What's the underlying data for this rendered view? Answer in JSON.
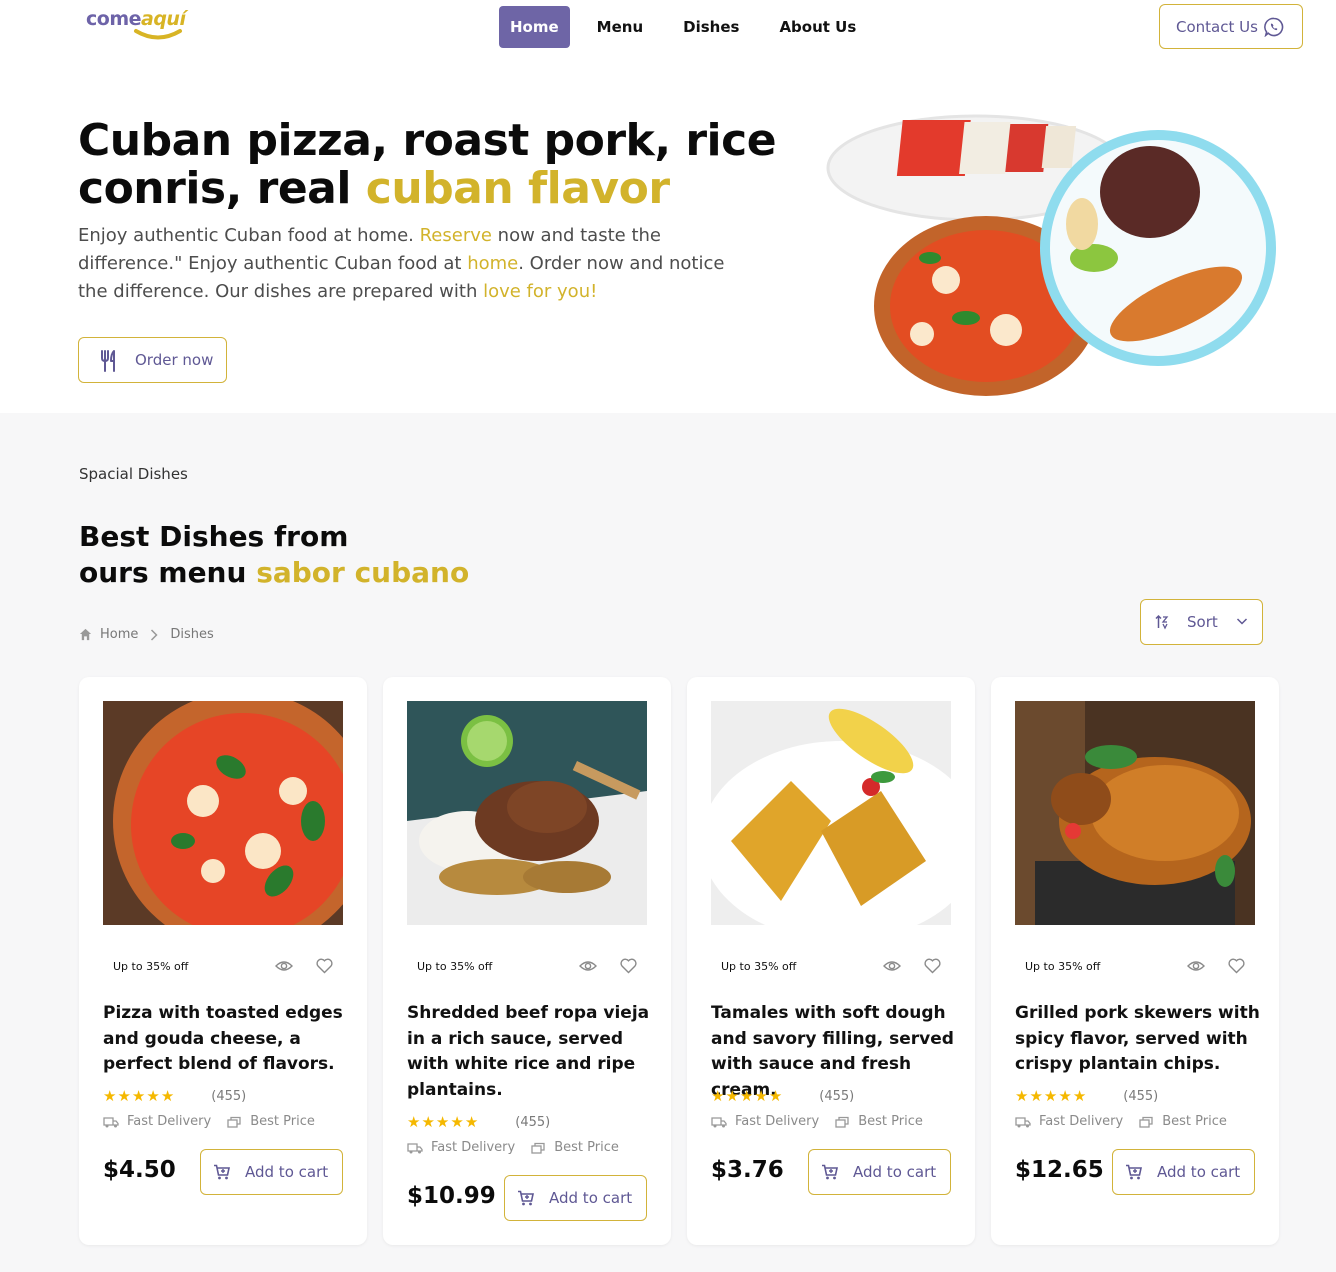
{
  "header": {
    "logo": {
      "part1": "come",
      "part2": "aquí"
    },
    "nav": [
      {
        "label": "Home",
        "active": true
      },
      {
        "label": "Menu",
        "active": false
      },
      {
        "label": "Dishes",
        "active": false
      },
      {
        "label": "About Us",
        "active": false
      }
    ],
    "contact_label": "Contact Us"
  },
  "hero": {
    "title_part1": "Cuban pizza, roast pork, rice conris, real ",
    "title_highlight": "cuban flavor",
    "text_a": "Enjoy authentic Cuban food at home. ",
    "text_hl1": "Reserve",
    "text_b": " now and taste the difference.\" Enjoy authentic Cuban food at ",
    "text_hl2": "home",
    "text_c": ". Order now and notice the difference. Our dishes are prepared with ",
    "text_hl3": "love for you!",
    "order_label": "Order now"
  },
  "section": {
    "eyebrow": "Spacial Dishes",
    "title_line1": "Best Dishes from",
    "title_line2": "ours menu ",
    "title_highlight": "sabor cubano",
    "breadcrumb": {
      "home": "Home",
      "current": "Dishes"
    },
    "sort_label": "Sort"
  },
  "dishes": [
    {
      "badge": "Up to 35% off",
      "title": "Pizza with toasted edges and gouda cheese, a perfect blend of flavors.",
      "rating": 5,
      "reviews": "(455)",
      "feature1": "Fast Delivery",
      "feature2": "Best Price",
      "price": "$4.50",
      "cart_label": "Add to cart"
    },
    {
      "badge": "Up to 35% off",
      "title": "Shredded beef ropa vieja in a rich sauce, served with white rice and ripe plantains.",
      "rating": 5,
      "reviews": "(455)",
      "feature1": "Fast Delivery",
      "feature2": "Best Price",
      "price": "$10.99",
      "cart_label": "Add to cart"
    },
    {
      "badge": "Up to 35% off",
      "title": "Tamales with soft dough and savory filling, served with sauce and fresh cream.",
      "rating": 5,
      "reviews": "(455)",
      "feature1": "Fast Delivery",
      "feature2": "Best Price",
      "price": "$3.76",
      "cart_label": "Add to cart"
    },
    {
      "badge": "Up to 35% off",
      "title": "Grilled pork skewers with spicy flavor, served with crispy plantain chips.",
      "rating": 5,
      "reviews": "(455)",
      "feature1": "Fast Delivery",
      "feature2": "Best Price",
      "price": "$12.65",
      "cart_label": "Add to cart"
    }
  ],
  "colors": {
    "accent": "#6e65a6",
    "highlight": "#d2b32b",
    "star": "#f5b800"
  },
  "icons": [
    "whatsapp-icon",
    "fork-knife-icon",
    "home-icon",
    "chevron-right-icon",
    "sort-icon",
    "chevron-down-icon",
    "eye-icon",
    "heart-icon",
    "star-icon",
    "truck-icon",
    "price-tag-icon",
    "cart-icon"
  ]
}
